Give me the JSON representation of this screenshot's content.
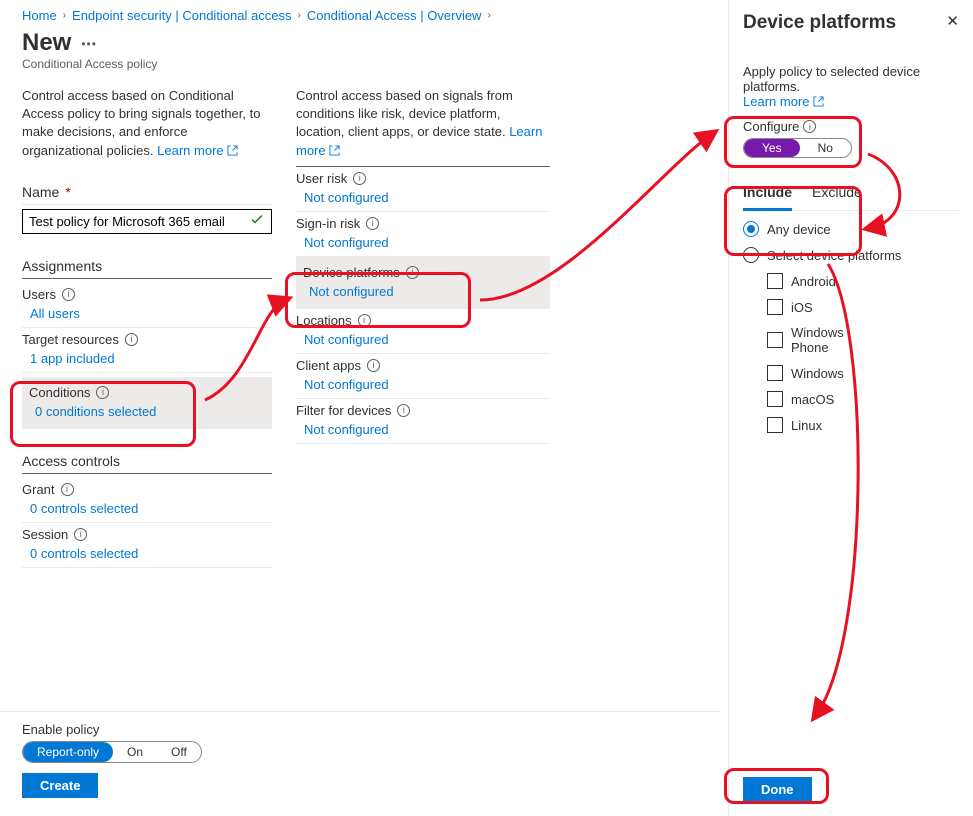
{
  "breadcrumb": {
    "items": [
      "Home",
      "Endpoint security | Conditional access",
      "Conditional Access | Overview"
    ]
  },
  "page": {
    "title": "New",
    "subtitle": "Conditional Access policy"
  },
  "col1": {
    "desc": "Control access based on Conditional Access policy to bring signals together, to make decisions, and enforce organizational policies.",
    "learn_more": "Learn more",
    "name_label": "Name",
    "name_value": "Test policy for Microsoft 365 email",
    "assignments_header": "Assignments",
    "users_label": "Users",
    "users_value": "All users",
    "target_label": "Target resources",
    "target_value": "1 app included",
    "conditions_label": "Conditions",
    "conditions_value": "0 conditions selected",
    "access_header": "Access controls",
    "grant_label": "Grant",
    "grant_value": "0 controls selected",
    "session_label": "Session",
    "session_value": "0 controls selected"
  },
  "col2": {
    "desc": "Control access based on signals from conditions like risk, device platform, location, client apps, or device state.",
    "learn_more": "Learn more",
    "items": [
      {
        "label": "User risk",
        "value": "Not configured"
      },
      {
        "label": "Sign-in risk",
        "value": "Not configured"
      },
      {
        "label": "Device platforms",
        "value": "Not configured"
      },
      {
        "label": "Locations",
        "value": "Not configured"
      },
      {
        "label": "Client apps",
        "value": "Not configured"
      },
      {
        "label": "Filter for devices",
        "value": "Not configured"
      }
    ]
  },
  "footer": {
    "enable_label": "Enable policy",
    "options": [
      "Report-only",
      "On",
      "Off"
    ],
    "create": "Create"
  },
  "panel": {
    "title": "Device platforms",
    "sub": "Apply policy to selected device platforms.",
    "learn_more": "Learn more",
    "configure_label": "Configure",
    "yes": "Yes",
    "no": "No",
    "tab_include": "Include",
    "tab_exclude": "Exclude",
    "any_device": "Any device",
    "select_platforms": "Select device platforms",
    "platforms": [
      "Android",
      "iOS",
      "Windows Phone",
      "Windows",
      "macOS",
      "Linux"
    ],
    "done": "Done"
  }
}
